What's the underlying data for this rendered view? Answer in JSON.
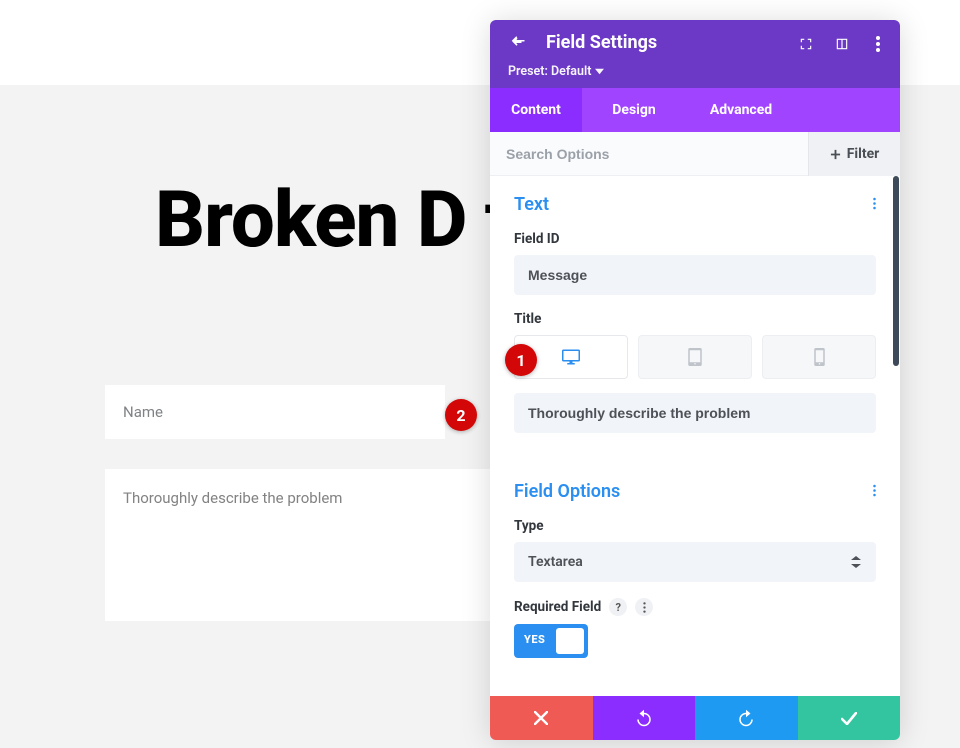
{
  "page": {
    "heading": "Broken D       ta",
    "name_field_label": "Name",
    "textarea_field_label": "Thoroughly describe the problem"
  },
  "panel": {
    "title": "Field Settings",
    "preset_label": "Preset: Default",
    "tabs": {
      "content": "Content",
      "design": "Design",
      "advanced": "Advanced"
    },
    "search_placeholder": "Search Options",
    "filter_label": "Filter",
    "sections": {
      "text": {
        "title": "Text",
        "field_id_label": "Field ID",
        "field_id_value": "Message",
        "title_label": "Title",
        "title_value": "Thoroughly describe the problem"
      },
      "options": {
        "title": "Field Options",
        "type_label": "Type",
        "type_value": "Textarea",
        "required_label": "Required Field",
        "required_value": "YES"
      }
    }
  },
  "markers": {
    "m1": "1",
    "m2": "2"
  }
}
